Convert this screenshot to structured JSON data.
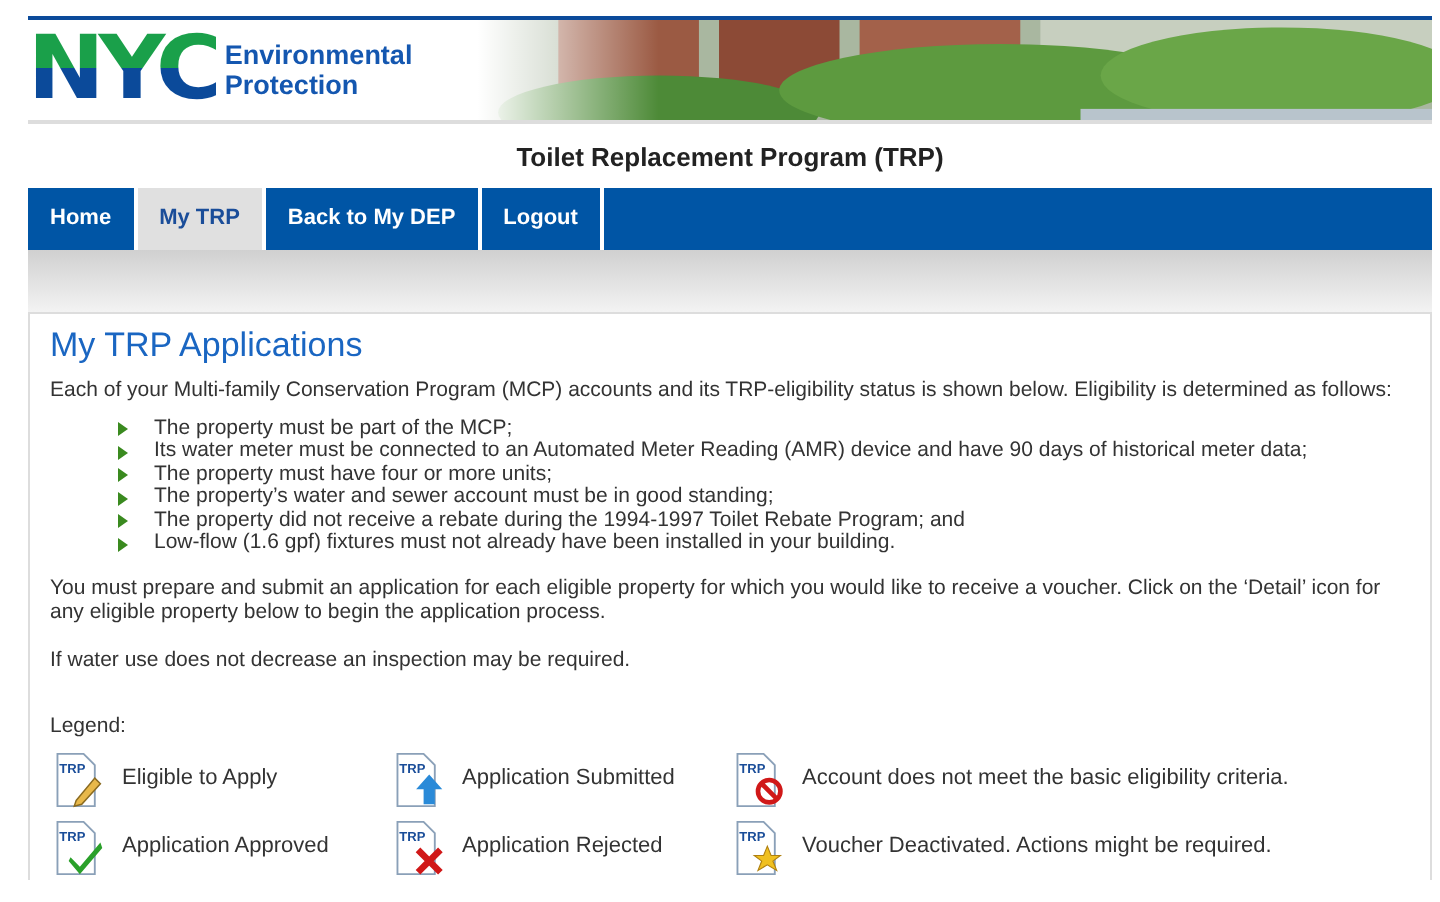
{
  "brand": {
    "mark": "NYC",
    "name_lines": [
      "Environmental",
      "Protection"
    ]
  },
  "program_title": "Toilet Replacement Program (TRP)",
  "nav": [
    {
      "label": "Home",
      "selected": false
    },
    {
      "label": "My TRP",
      "selected": true
    },
    {
      "label": "Back to My DEP",
      "selected": false
    },
    {
      "label": "Logout",
      "selected": false
    }
  ],
  "content": {
    "heading": "My TRP Applications",
    "intro": "Each of your Multi-family Conservation Program (MCP) accounts and its TRP-eligibility status is shown below. Eligibility is determined as follows:",
    "criteria": [
      "The property must be part of the MCP;",
      "Its water meter must be connected to an Automated Meter Reading (AMR) device and have 90 days of historical meter data;",
      "The property must have four or more units;",
      "The property’s water and sewer account must be in good standing;",
      "The property did not receive a rebate during the 1994-1997 Toilet Rebate Program; and",
      "Low-flow (1.6 gpf) fixtures must not already have been installed in your building."
    ],
    "instructions": "You must prepare and submit an application for each eligible property for which you would like to receive a voucher. Click on the ‘Detail’ icon for any eligible property below to begin the application process.",
    "note": "If water use does not decrease an inspection may be required.",
    "legend_title": "Legend:",
    "legend": [
      {
        "kind": "eligible",
        "icon_text": "TRP",
        "label": "Eligible to Apply"
      },
      {
        "kind": "submitted",
        "icon_text": "TRP",
        "label": "Application Submitted"
      },
      {
        "kind": "ineligible",
        "icon_text": "TRP",
        "label": "Account does not meet the basic eligibility criteria."
      },
      {
        "kind": "approved",
        "icon_text": "TRP",
        "label": "Application Approved"
      },
      {
        "kind": "rejected",
        "icon_text": "TRP",
        "label": "Application Rejected"
      },
      {
        "kind": "deactivated",
        "icon_text": "TRP",
        "label": "Voucher Deactivated. Actions might be required."
      }
    ]
  }
}
